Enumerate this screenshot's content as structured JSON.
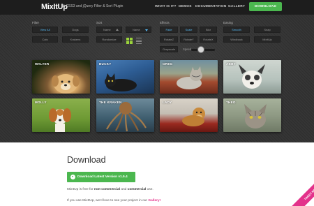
{
  "header": {
    "logo": "MixItUp",
    "tagline": "A CSS3 and jQuery Filter & Sort Plugin",
    "nav": [
      "WHAT IS IT?",
      "DEMOS",
      "DOCUMENTATION",
      "GALLERY"
    ],
    "download_label": "DOWNLOAD"
  },
  "controls": {
    "filter": {
      "label": "Filter",
      "buttons": [
        "View All",
        "Dogs",
        "Cats",
        "Krakens"
      ],
      "active": "View All"
    },
    "sort": {
      "label": "Sort",
      "buttons": [
        "Name",
        "Name",
        "Randomize"
      ],
      "active_direction": "descending"
    },
    "effects": {
      "label": "Effects",
      "buttons": [
        "Fade",
        "Scale",
        "Blur",
        "RotateZ",
        "RotateY",
        "RotateX",
        "Grayscale"
      ],
      "active": [
        "Fade",
        "Scale"
      ],
      "speed_label": "Speed",
      "speed_value": 0.4
    },
    "easing": {
      "label": "Easing",
      "buttons": [
        "Smooth",
        "Snap",
        "Windback",
        "MixItUp"
      ],
      "active": "Smooth"
    },
    "accent_color": "#55b9f3",
    "grid_icon_color": "#9bd43b"
  },
  "cards": [
    {
      "name": "WALTER",
      "kind": "dog"
    },
    {
      "name": "BUCKY",
      "kind": "cat"
    },
    {
      "name": "GREG",
      "kind": "cat"
    },
    {
      "name": "ABBY",
      "kind": "dog"
    },
    {
      "name": "MOLLY",
      "kind": "dog"
    },
    {
      "name": "THE KRAKEN",
      "kind": "kraken"
    },
    {
      "name": "LADY",
      "kind": "dog"
    },
    {
      "name": "THEO",
      "kind": "cat"
    }
  ],
  "download": {
    "title": "Download",
    "button_label": "Download Latest Version v1.5.4",
    "line1_pre": "MixItUp is free for ",
    "line1_b1": "non-commercial",
    "line1_mid": " and ",
    "line1_b2": "commercial",
    "line1_post": " use.",
    "line2_pre": "If you use MixItUp, we'd love to see your project in our ",
    "line2_link": "Gallery!",
    "ribbon": "TWEET ME"
  },
  "colors": {
    "brand_green": "#4bb74f",
    "header_bg": "#1d1d1d",
    "link_pink": "#e3328b"
  }
}
